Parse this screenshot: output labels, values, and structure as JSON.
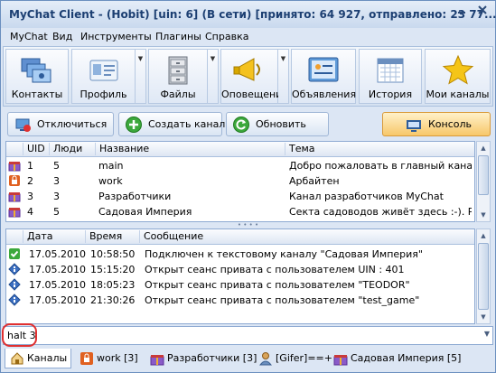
{
  "window": {
    "title": "MyChat Client - (Hobit) [uin: 6] (В сети) [принято: 64 927, отправлено: 23 77..."
  },
  "menu": [
    "MyChat",
    "Вид",
    "Инструменты",
    "Плагины",
    "Справка"
  ],
  "ribbon": [
    "Контакты",
    "Профиль",
    "Файлы",
    "Оповещения",
    "Объявления",
    "История",
    "Мои каналы"
  ],
  "toolbar": {
    "disconnect": "Отключиться",
    "create_channel": "Создать канал",
    "refresh": "Обновить",
    "console": "Консоль"
  },
  "channels": {
    "headers": [
      "UID",
      "Люди",
      "Название",
      "Тема"
    ],
    "rows": [
      {
        "uid": "1",
        "people": "5",
        "name": "main",
        "topic": "Добро пожаловать в главный канал ..."
      },
      {
        "uid": "2",
        "people": "3",
        "name": "work",
        "topic": "Арбайтен"
      },
      {
        "uid": "3",
        "people": "3",
        "name": "Разработчики",
        "topic": "Канал разработчиков MyChat"
      },
      {
        "uid": "4",
        "people": "5",
        "name": "Садовая Империя",
        "topic": "Секта садоводов живёт здесь :-). Ра..."
      }
    ]
  },
  "log": {
    "headers": [
      "Дата",
      "Время",
      "Сообщение"
    ],
    "rows": [
      {
        "date": "17.05.2010",
        "time": "10:58:50",
        "message": "Подключен к текстовому каналу \"Садовая Империя\""
      },
      {
        "date": "17.05.2010",
        "time": "15:15:20",
        "message": "Открыт сеанс привата с пользователем UIN : 401"
      },
      {
        "date": "17.05.2010",
        "time": "18:05:23",
        "message": "Открыт сеанс привата с пользователем \"TEODOR\""
      },
      {
        "date": "17.05.2010",
        "time": "21:30:26",
        "message": "Открыт сеанс привата с пользователем \"test_game\""
      }
    ]
  },
  "console_input": {
    "value": "halt 3"
  },
  "tabs": [
    "Каналы",
    "work [3]",
    "Разработчики [3]",
    "[Gifer]==+",
    "Садовая Империя [5]"
  ],
  "colors": {
    "accent": "#1c3f72",
    "highlight": "#e03030",
    "console": "#f7c76a"
  }
}
